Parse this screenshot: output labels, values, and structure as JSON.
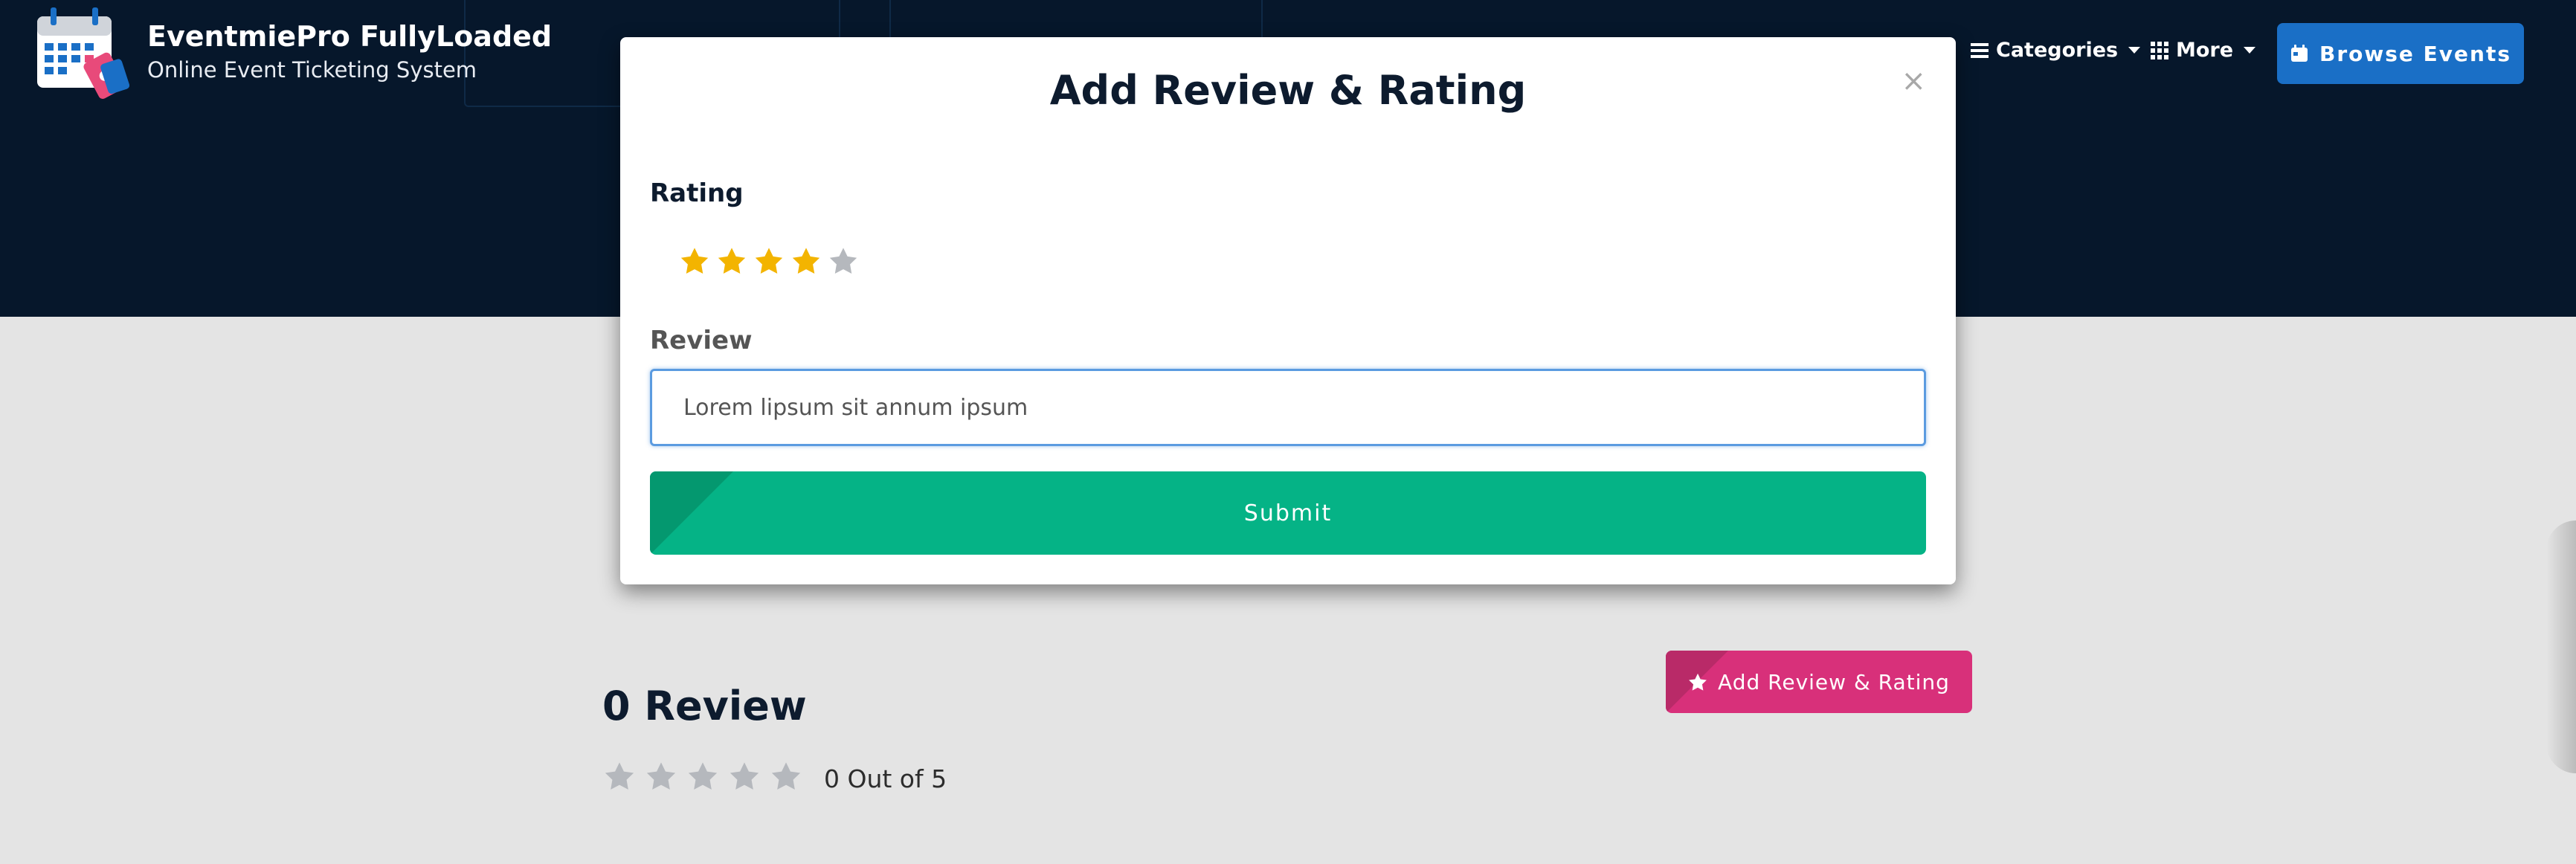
{
  "header": {
    "brand_title": "EventmiePro FullyLoaded",
    "brand_subtitle": "Online Event Ticketing System",
    "logo_icon": "calendar-ticket-icon",
    "nav": [
      {
        "label": "Categories",
        "icon": "bars-icon"
      },
      {
        "label": "More",
        "icon": "grid-icon"
      }
    ],
    "browse_button": {
      "label": "Browse Events",
      "icon": "calendar-icon"
    }
  },
  "modal": {
    "title": "Add Review & Rating",
    "close_symbol": "×",
    "rating_label": "Rating",
    "rating_value": 4,
    "rating_max": 5,
    "review_label": "Review",
    "review_value": "Lorem lipsum sit annum ipsum",
    "submit_label": "Submit"
  },
  "reviews": {
    "title": "0 Review",
    "average_text": "0 Out of 5",
    "average_stars": 0,
    "add_button_label": "Add Review & Rating"
  },
  "colors": {
    "header_bg": "#06172b",
    "page_bg": "#e4e4e4",
    "brand_blue": "#1a6fc6",
    "submit_green": "#05b386",
    "pink": "#d8307a",
    "star_filled": "#f3b400",
    "star_empty": "#b5b8bd"
  }
}
